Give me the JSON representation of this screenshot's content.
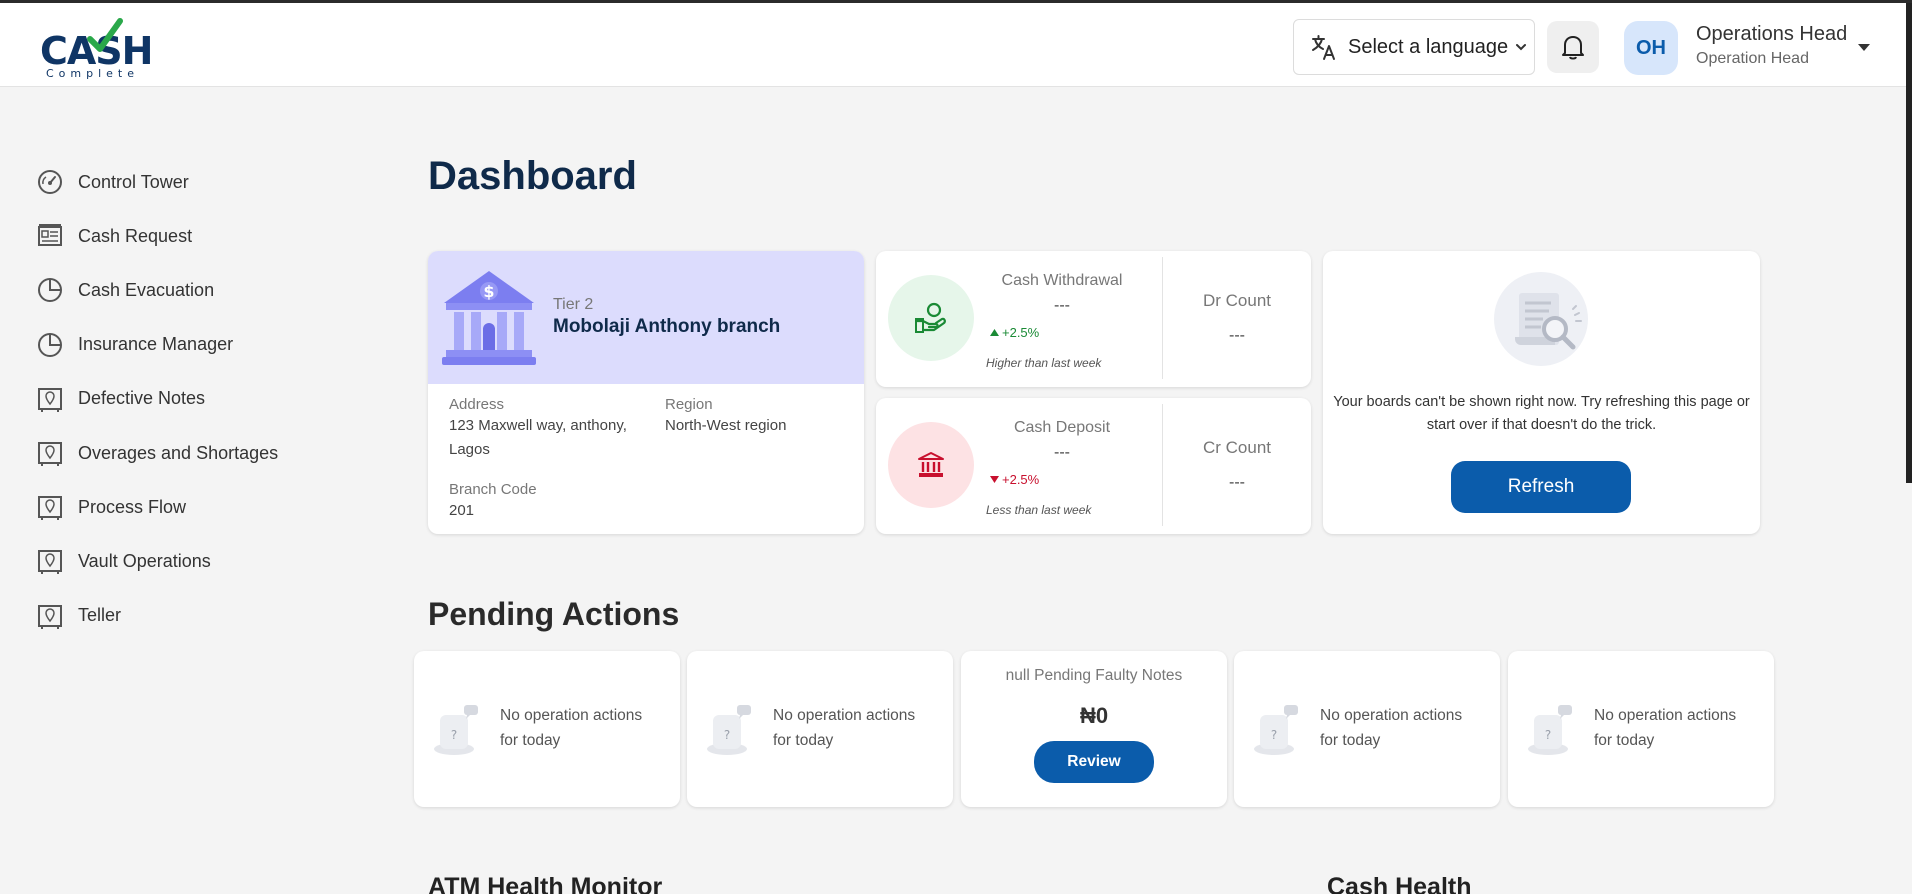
{
  "header": {
    "logo_main": "CASH",
    "logo_sub": "Complete",
    "language_label": "Select a language",
    "avatar_initials": "OH",
    "user_name": "Operations Head",
    "user_role": "Operation Head"
  },
  "sidebar": {
    "items": [
      {
        "label": "Control Tower",
        "icon": "speedometer-icon"
      },
      {
        "label": "Cash Request",
        "icon": "form-icon"
      },
      {
        "label": "Cash Evacuation",
        "icon": "pie-chart-icon"
      },
      {
        "label": "Insurance Manager",
        "icon": "pie-chart-icon"
      },
      {
        "label": "Defective Notes",
        "icon": "map-pin-frame-icon"
      },
      {
        "label": "Overages and Shortages",
        "icon": "map-pin-frame-icon"
      },
      {
        "label": "Process Flow",
        "icon": "map-pin-frame-icon"
      },
      {
        "label": "Vault Operations",
        "icon": "map-pin-frame-icon"
      },
      {
        "label": "Teller",
        "icon": "map-pin-frame-icon"
      }
    ]
  },
  "dashboard": {
    "title": "Dashboard",
    "branch": {
      "tier": "Tier 2",
      "name": "Mobolaji Anthony branch",
      "address_label": "Address",
      "address_line1": "123 Maxwell way, anthony,",
      "address_line2": "Lagos",
      "region_label": "Region",
      "region": "North-West region",
      "code_label": "Branch Code",
      "code": "201"
    },
    "withdrawal": {
      "title": "Cash Withdrawal",
      "value": "---",
      "change": "+2.5%",
      "note": "Higher than last week",
      "count_label": "Dr Count",
      "count_value": "---",
      "color": "#1a8a35"
    },
    "deposit": {
      "title": "Cash Deposit",
      "value": "---",
      "change": "+2.5%",
      "note": "Less than last week",
      "count_label": "Cr Count",
      "count_value": "---",
      "color": "#c8102e"
    },
    "boards_error": {
      "line1": "Your boards can't be shown right now. Try refreshing this page or",
      "line2": "start over if that doesn't do the trick.",
      "refresh_label": "Refresh"
    }
  },
  "pending": {
    "title": "Pending Actions",
    "empty_line1": "No operation actions",
    "empty_line2": "for today",
    "faulty_title": "null Pending Faulty Notes",
    "faulty_amount": "₦0",
    "review_label": "Review"
  },
  "bottom": {
    "atm_title": "ATM Health Monitor",
    "cash_health_title": "Cash Health"
  },
  "colors": {
    "primary": "#0b5cab",
    "navy": "#0f2a4a",
    "branch_bg": "#dcdcfd",
    "withdrawal_bg": "#e6f6ea",
    "deposit_bg": "#fde2e4"
  }
}
